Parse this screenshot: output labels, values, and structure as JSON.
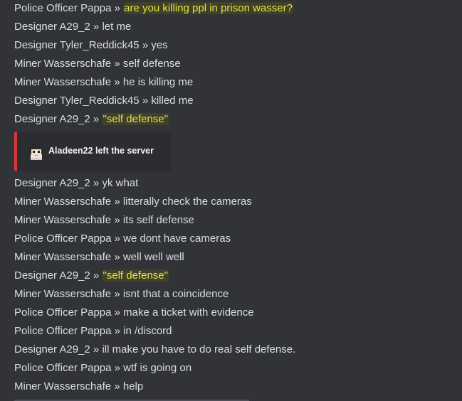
{
  "messages": [
    {
      "sender": "Police Officer Pappa",
      "sep": "»",
      "text": "are you killing ppl in prison wasser?",
      "highlight": true
    },
    {
      "sender": "Designer A29_2",
      "sep": "»",
      "text": "let me",
      "highlight": false
    },
    {
      "sender": "Designer Tyler_Reddick45",
      "sep": "»",
      "text": "yes",
      "highlight": false
    },
    {
      "sender": "Miner Wasserschafe",
      "sep": "»",
      "text": "self defense",
      "highlight": false
    },
    {
      "sender": "Miner Wasserschafe",
      "sep": "»",
      "text": "he is killing me",
      "highlight": false
    },
    {
      "sender": "Designer Tyler_Reddick45",
      "sep": "»",
      "text": "killed me",
      "highlight": false
    },
    {
      "sender": "Designer A29_2",
      "sep": "»",
      "text": "\"self defense\"",
      "highlight": true
    }
  ],
  "embed": {
    "text": "Aladeen22 left the server",
    "accent": "#da373c"
  },
  "messages_after": [
    {
      "sender": "Designer A29_2",
      "sep": "»",
      "text": "yk what",
      "highlight": false
    },
    {
      "sender": "Miner Wasserschafe",
      "sep": "»",
      "text": "litterally check the cameras",
      "highlight": false
    },
    {
      "sender": "Miner Wasserschafe",
      "sep": "»",
      "text": "its self defense",
      "highlight": false
    },
    {
      "sender": "Police Officer Pappa",
      "sep": "»",
      "text": "we dont have cameras",
      "highlight": false
    },
    {
      "sender": "Miner Wasserschafe",
      "sep": "»",
      "text": "well well well",
      "highlight": false
    },
    {
      "sender": "Designer A29_2",
      "sep": "»",
      "text": "\"self defense\"",
      "highlight": true
    },
    {
      "sender": "Miner Wasserschafe",
      "sep": "»",
      "text": "isnt that a coincidence",
      "highlight": false
    },
    {
      "sender": "Police Officer Pappa",
      "sep": "»",
      "text": "make a ticket with evidence",
      "highlight": false
    },
    {
      "sender": "Police Officer Pappa",
      "sep": "»",
      "text": "in /discord",
      "highlight": false
    },
    {
      "sender": "Designer A29_2",
      "sep": "»",
      "text": "ill make you have to do real self defense.",
      "highlight": false
    },
    {
      "sender": "Police Officer Pappa",
      "sep": "»",
      "text": "wtf is going on",
      "highlight": false
    },
    {
      "sender": "Miner Wasserschafe",
      "sep": "»",
      "text": "help",
      "highlight": false
    }
  ],
  "colors": {
    "background": "#313338",
    "text": "#dbdee1",
    "highlight_text": "#e6e24a",
    "highlight_bg": "#3f4128",
    "embed_bg": "#2b2d31"
  }
}
